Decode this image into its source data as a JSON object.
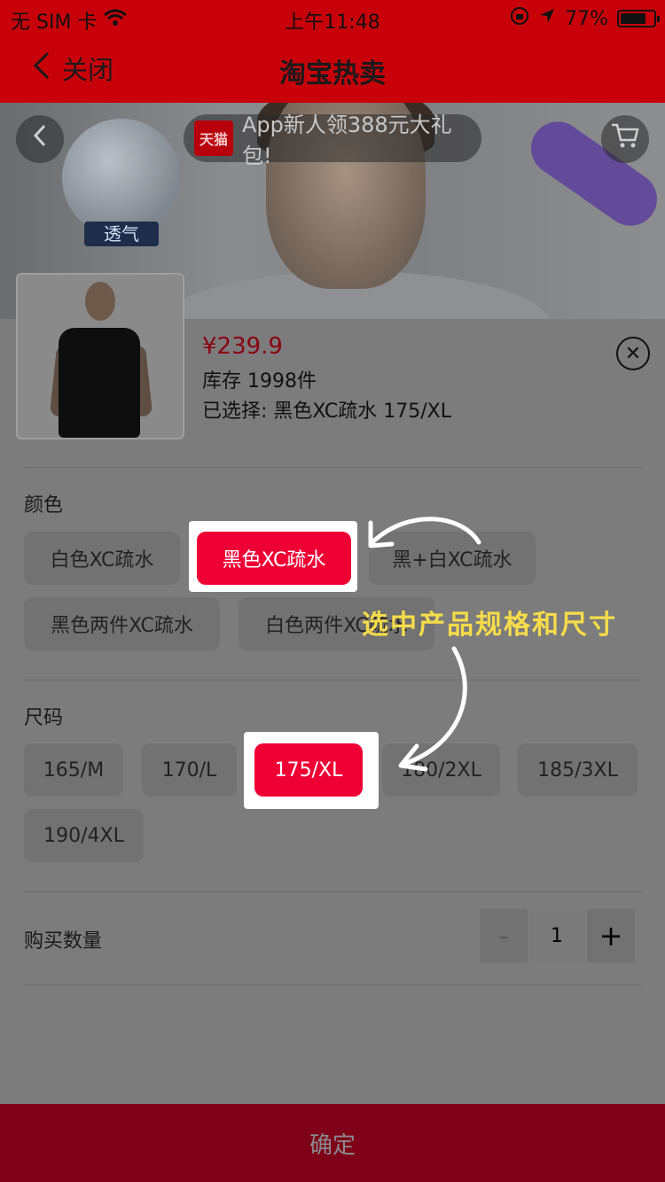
{
  "status_bar": {
    "carrier": "无 SIM 卡",
    "time": "上午11:48",
    "battery": "77%",
    "battery_level": 0.77
  },
  "nav": {
    "back_label": "关闭",
    "title": "淘宝热卖"
  },
  "hero": {
    "promo_badge": "天猫",
    "promo_text": "App新人领388元大礼包!",
    "fabric_tag": "透气"
  },
  "product": {
    "price": "¥239.9",
    "stock": "库存 1998件",
    "selected": "已选择: 黑色XC疏水   175/XL"
  },
  "color_section": {
    "title": "颜色",
    "options": [
      {
        "label": "白色XC疏水",
        "selected": false
      },
      {
        "label": "黑色XC疏水",
        "selected": true
      },
      {
        "label": "黑+白XC疏水",
        "selected": false
      },
      {
        "label": "黑色两件XC疏水",
        "selected": false
      },
      {
        "label": "白色两件XC疏水",
        "selected": false
      }
    ]
  },
  "size_section": {
    "title": "尺码",
    "options": [
      {
        "label": "165/M",
        "selected": false
      },
      {
        "label": "170/L",
        "selected": false
      },
      {
        "label": "175/XL",
        "selected": true
      },
      {
        "label": "180/2XL",
        "selected": false
      },
      {
        "label": "185/3XL",
        "selected": false
      },
      {
        "label": "190/4XL",
        "selected": false
      }
    ]
  },
  "quantity": {
    "label": "购买数量",
    "minus": "-",
    "value": "1",
    "plus": "+"
  },
  "confirm_label": "确定",
  "annotation": "选中产品规格和尺寸",
  "colors": {
    "brand_red": "#c8000a",
    "chip_active": "#ee0035",
    "annotation": "#f6dc4a"
  }
}
